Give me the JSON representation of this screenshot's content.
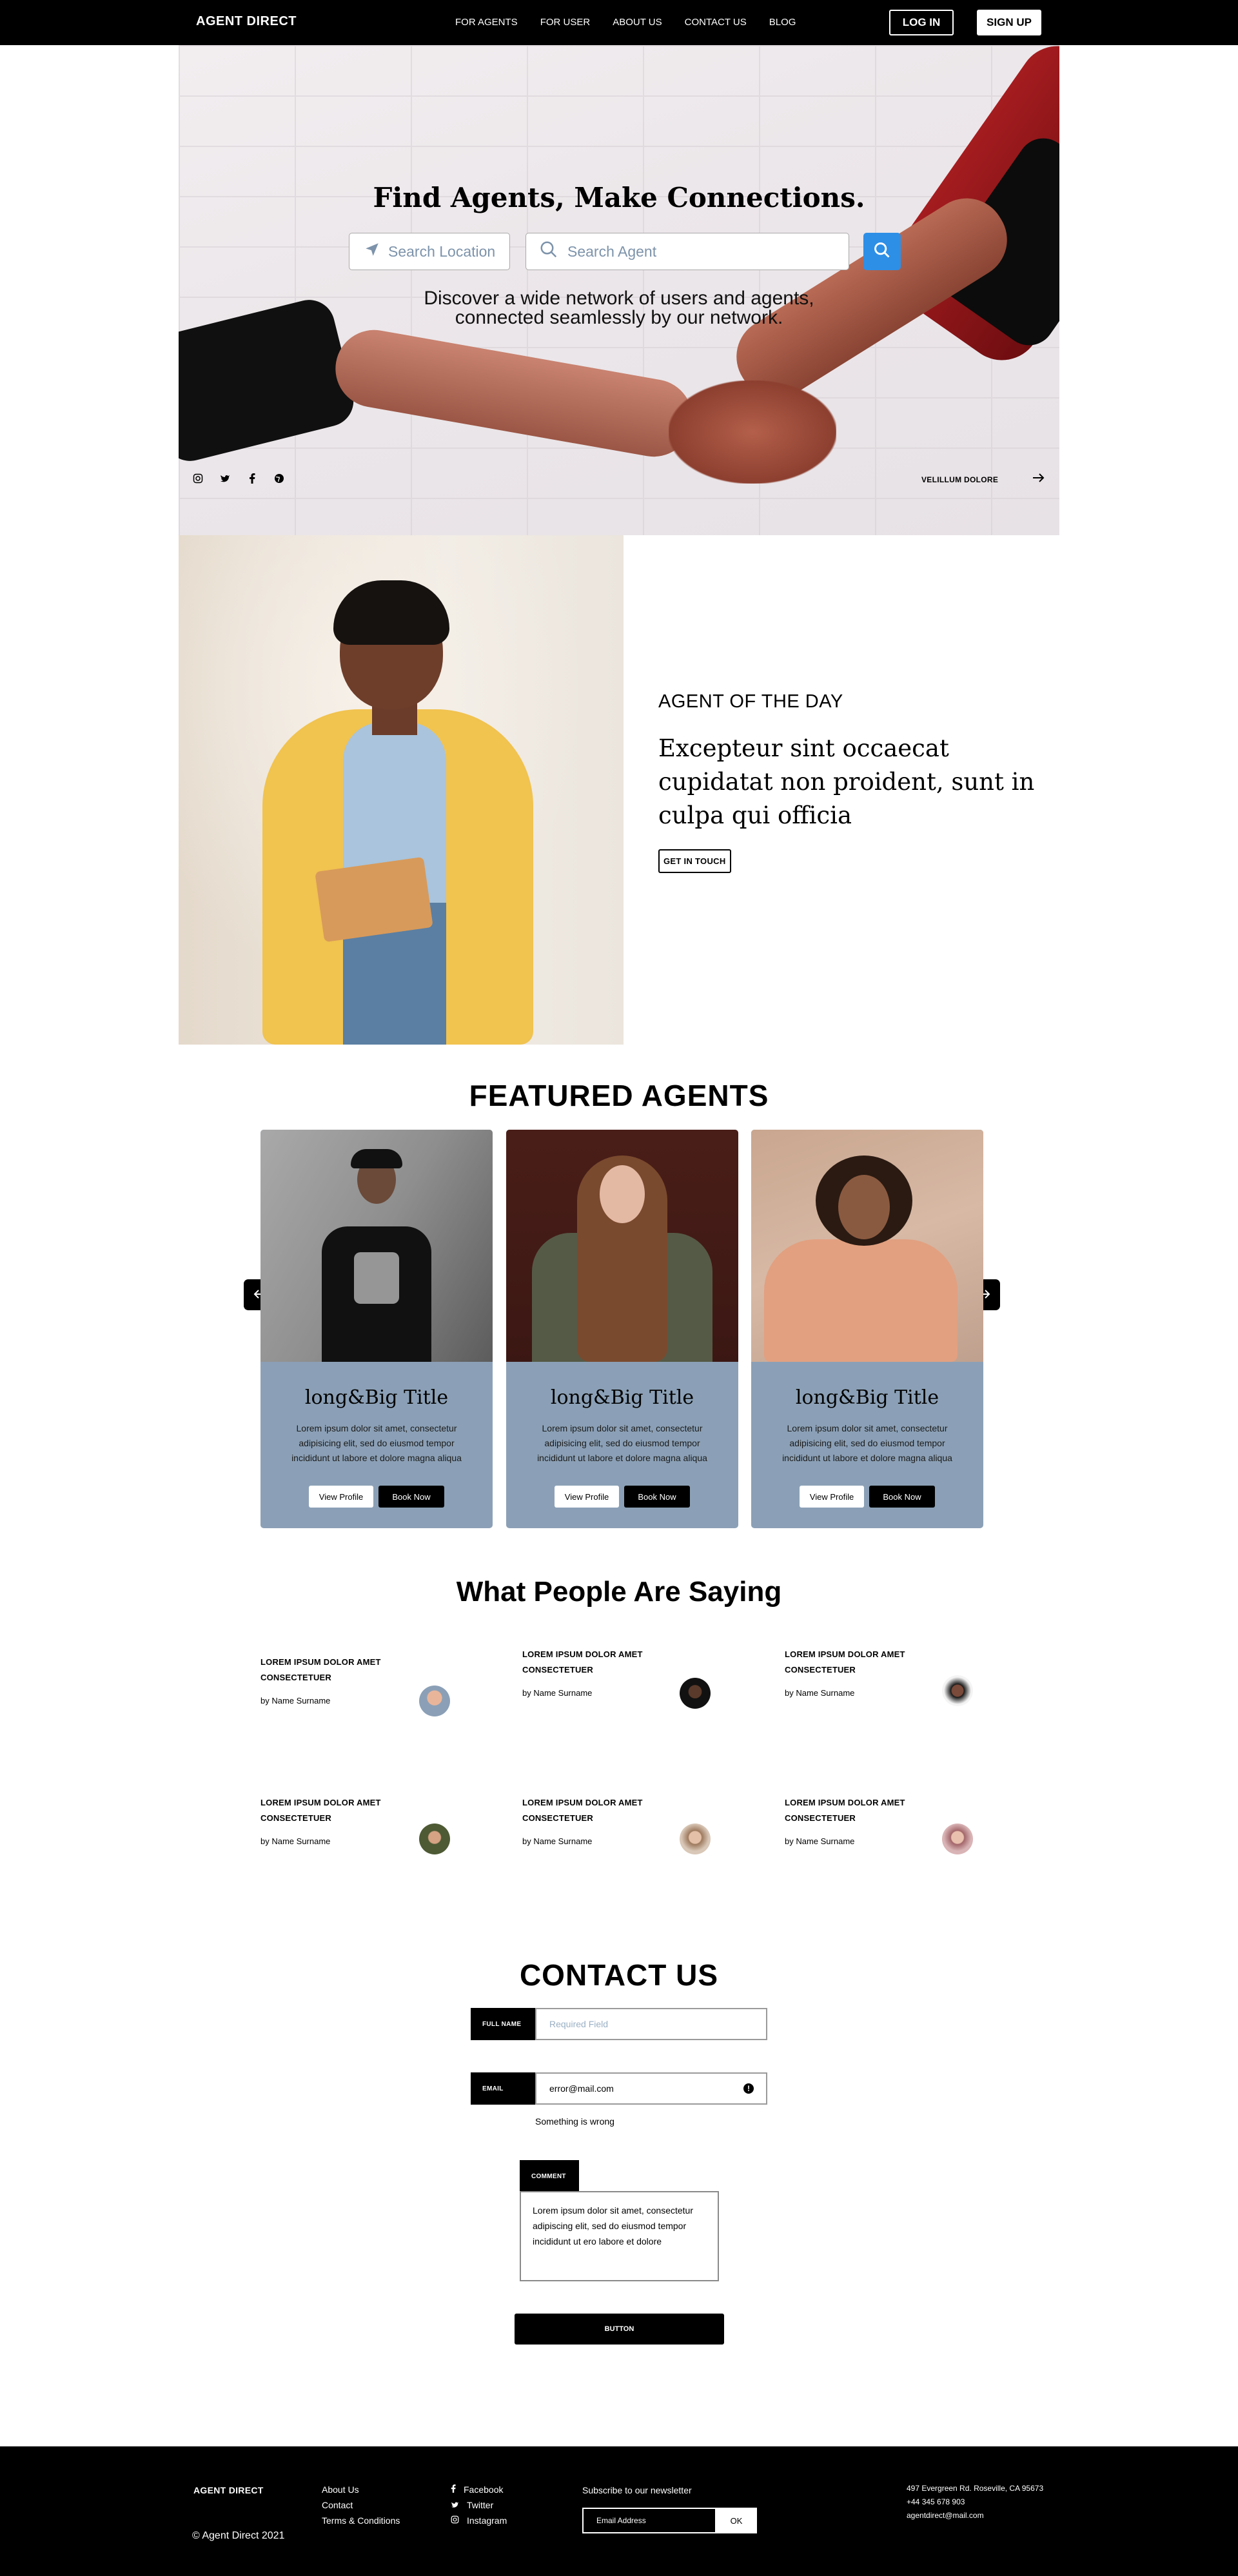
{
  "nav": {
    "brand": "AGENT DIRECT",
    "links": [
      "FOR AGENTS",
      "FOR USER",
      "ABOUT US",
      "CONTACT US",
      "BLOG"
    ],
    "login": "LOG IN",
    "signup": "SIGN UP"
  },
  "hero": {
    "title": "Find Agents, Make Connections.",
    "location_placeholder": "Search Location",
    "agent_placeholder": "Search Agent",
    "tagline_line1": "Discover a wide network of users and agents,",
    "tagline_line2": "connected seamlessly by our network.",
    "link": "VELILLUM DOLORE",
    "social_icons": [
      "instagram-icon",
      "twitter-icon",
      "facebook-icon",
      "globe-icon"
    ]
  },
  "agent_of_day": {
    "eyebrow": "AGENT OF THE DAY",
    "quote": "Excepteur sint occaecat cupidatat non proident, sunt in culpa qui officia",
    "button": "GET IN TOUCH"
  },
  "featured": {
    "title": "FEATURED AGENTS",
    "cards": [
      {
        "title": "long&Big Title",
        "text": "Lorem ipsum dolor sit amet, consectetur adipisicing elit, sed do eiusmod tempor incididunt ut labore et dolore magna aliqua",
        "view": "View Profile",
        "book": "Book Now"
      },
      {
        "title": "long&Big Title",
        "text": "Lorem ipsum dolor sit amet, consectetur adipisicing elit, sed do eiusmod tempor incididunt ut labore et dolore magna aliqua",
        "view": "View Profile",
        "book": "Book Now"
      },
      {
        "title": "long&Big Title",
        "text": "Lorem ipsum dolor sit amet, consectetur adipisicing elit, sed do eiusmod tempor incididunt ut labore et dolore magna aliqua",
        "view": "View Profile",
        "book": "Book Now"
      }
    ]
  },
  "testimonials": {
    "title": "What People Are Saying",
    "items": [
      {
        "line1": "LOREM IPSUM DOLOR AMET",
        "line2": "CONSECTETUER",
        "by": "by Name Surname"
      },
      {
        "line1": "LOREM IPSUM DOLOR AMET",
        "line2": "CONSECTETUER",
        "by": "by Name Surname"
      },
      {
        "line1": "LOREM IPSUM DOLOR AMET",
        "line2": "CONSECTETUER",
        "by": "by Name Surname"
      },
      {
        "line1": "LOREM IPSUM DOLOR AMET",
        "line2": "CONSECTETUER",
        "by": "by Name Surname"
      },
      {
        "line1": "LOREM IPSUM DOLOR AMET",
        "line2": "CONSECTETUER",
        "by": "by Name Surname"
      },
      {
        "line1": "LOREM IPSUM DOLOR AMET",
        "line2": "CONSECTETUER",
        "by": "by Name Surname"
      }
    ]
  },
  "contact": {
    "title": "CONTACT US",
    "full_name_label": "FULL NAME",
    "full_name_placeholder": "Required Field",
    "email_label": "EMAIL",
    "email_value": "error@mail.com",
    "email_error": "Something is wrong",
    "comment_label": "COMMENT",
    "comment_line1": "Lorem ipsum dolor sit amet, consectetur",
    "comment_line2": "adipiscing elit, sed do eiusmod tempor",
    "comment_line3": "incididunt ut ero labore et dolore",
    "submit": "BUTTON"
  },
  "footer": {
    "brand": "AGENT DIRECT",
    "copyright": "© Agent Direct 2021",
    "links": [
      "About Us",
      "Contact",
      "Terms & Conditions"
    ],
    "social": [
      "Facebook",
      "Twitter",
      "Instagram"
    ],
    "newsletter": "Subscribe to our newsletter",
    "email_placeholder": "Email Address",
    "ok": "OK",
    "address": "497 Evergreen Rd. Roseville, CA 95673",
    "phone": "+44 345 678 903",
    "email": "agentdirect@mail.com"
  },
  "colors": {
    "accent_blue": "#2d8fe6",
    "card_bg": "#8ba0b6",
    "black": "#000000"
  }
}
